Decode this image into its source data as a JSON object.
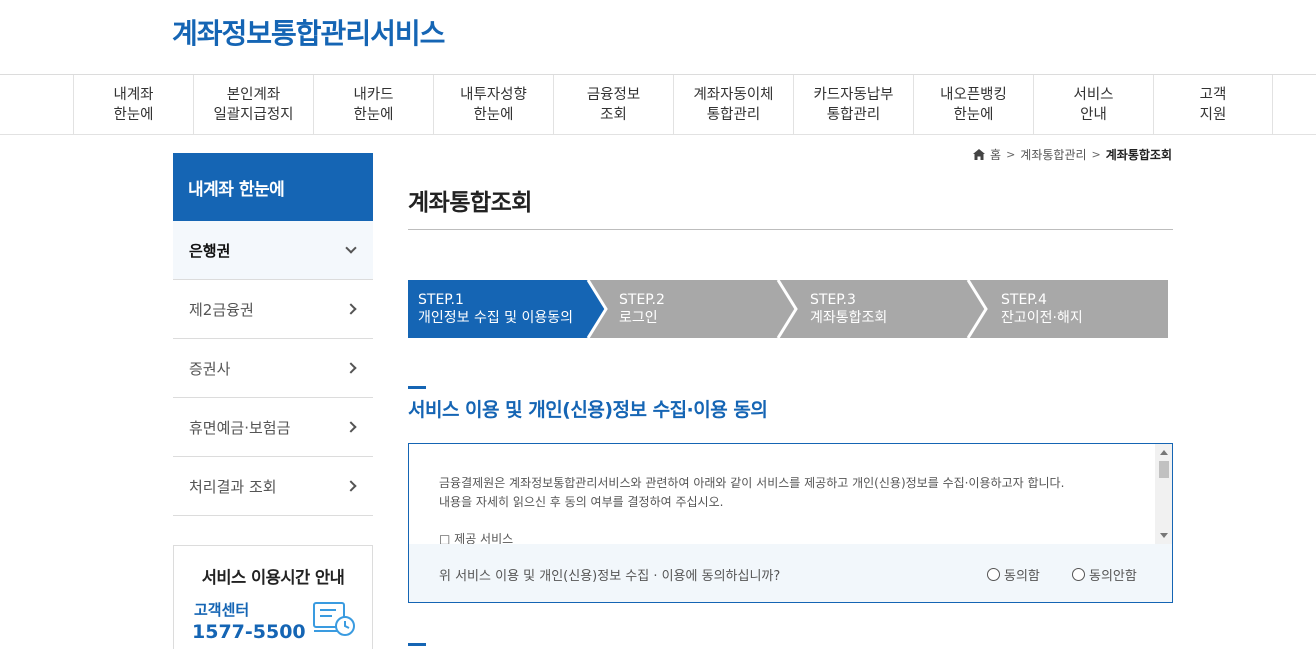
{
  "header": {
    "logo": "계좌정보통합관리서비스"
  },
  "gnb": [
    {
      "label": "내계좌\n한눈에"
    },
    {
      "label": "본인계좌\n일괄지급정지"
    },
    {
      "label": "내카드\n한눈에"
    },
    {
      "label": "내투자성향\n한눈에"
    },
    {
      "label": "금융정보\n조회"
    },
    {
      "label": "계좌자동이체\n통합관리"
    },
    {
      "label": "카드자동납부\n통합관리"
    },
    {
      "label": "내오픈뱅킹\n한눈에"
    },
    {
      "label": "서비스\n안내"
    },
    {
      "label": "고객\n지원"
    }
  ],
  "lnb": {
    "title": "내계좌 한눈에",
    "items": [
      {
        "label": "은행권"
      },
      {
        "label": "제2금융권"
      },
      {
        "label": "증권사"
      },
      {
        "label": "휴면예금·보험금"
      },
      {
        "label": "처리결과 조회"
      }
    ]
  },
  "service_hours": {
    "title": "서비스 이용시간 안내",
    "center_label": "고객센터",
    "phone": "1577-5500"
  },
  "breadcrumb": {
    "home": "홈",
    "level1": "계좌통합관리",
    "current": "계좌통합조회"
  },
  "page": {
    "title": "계좌통합조회"
  },
  "steps": [
    {
      "step": "STEP.1",
      "label": "개인정보 수집 및 이용동의"
    },
    {
      "step": "STEP.2",
      "label": "로그인"
    },
    {
      "step": "STEP.3",
      "label": "계좌통합조회"
    },
    {
      "step": "STEP.4",
      "label": "잔고이전·해지"
    }
  ],
  "colors": {
    "primary": "#1565b4",
    "step_inactive": "#a8a8a8"
  },
  "section": {
    "title": "서비스 이용 및 개인(신용)정보 수집·이용 동의"
  },
  "consent": {
    "line1": "금융결제원은 계좌정보통합관리서비스와 관련하여 아래와 같이 서비스를 제공하고 개인(신용)정보를 수집·이용하고자 합니다.",
    "line2": "내용을 자세히 읽으신 후 동의 여부를 결정하여 주십시오.",
    "service_heading": "□ 제공 서비스",
    "question": "위 서비스 이용 및 개인(신용)정보 수집 · 이용에 동의하십니까?",
    "agree_label": "동의함",
    "disagree_label": "동의안함"
  }
}
